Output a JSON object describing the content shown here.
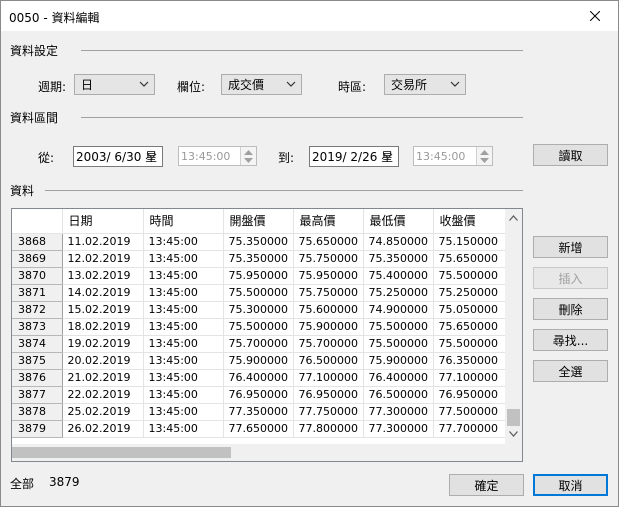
{
  "window": {
    "title": "0050 - 資料編輯"
  },
  "settings": {
    "group_label": "資料設定",
    "period_label": "週期:",
    "period_value": "日",
    "field_label": "欄位:",
    "field_value": "成交價",
    "timezone_label": "時區:",
    "timezone_value": "交易所"
  },
  "range": {
    "group_label": "資料區間",
    "from_label": "從:",
    "from_date": "2003/ 6/30 星",
    "from_time": "13:45:00",
    "to_label": "到:",
    "to_date": "2019/ 2/26 星",
    "to_time": "13:45:00",
    "read_button": "讀取"
  },
  "data_section": {
    "group_label": "資料",
    "columns": [
      "日期",
      "時間",
      "開盤價",
      "最高價",
      "最低價",
      "收盤價"
    ],
    "rows": [
      {
        "id": "3868",
        "cells": [
          "11.02.2019",
          "13:45:00",
          "75.350000",
          "75.650000",
          "74.850000",
          "75.150000"
        ]
      },
      {
        "id": "3869",
        "cells": [
          "12.02.2019",
          "13:45:00",
          "75.350000",
          "75.750000",
          "75.350000",
          "75.650000"
        ]
      },
      {
        "id": "3870",
        "cells": [
          "13.02.2019",
          "13:45:00",
          "75.950000",
          "75.950000",
          "75.400000",
          "75.500000"
        ]
      },
      {
        "id": "3871",
        "cells": [
          "14.02.2019",
          "13:45:00",
          "75.500000",
          "75.750000",
          "75.250000",
          "75.250000"
        ]
      },
      {
        "id": "3872",
        "cells": [
          "15.02.2019",
          "13:45:00",
          "75.300000",
          "75.600000",
          "74.900000",
          "75.050000"
        ]
      },
      {
        "id": "3873",
        "cells": [
          "18.02.2019",
          "13:45:00",
          "75.500000",
          "75.900000",
          "75.500000",
          "75.650000"
        ]
      },
      {
        "id": "3874",
        "cells": [
          "19.02.2019",
          "13:45:00",
          "75.700000",
          "75.700000",
          "75.500000",
          "75.500000"
        ]
      },
      {
        "id": "3875",
        "cells": [
          "20.02.2019",
          "13:45:00",
          "75.900000",
          "76.500000",
          "75.900000",
          "76.350000"
        ]
      },
      {
        "id": "3876",
        "cells": [
          "21.02.2019",
          "13:45:00",
          "76.400000",
          "77.100000",
          "76.400000",
          "77.100000"
        ]
      },
      {
        "id": "3877",
        "cells": [
          "22.02.2019",
          "13:45:00",
          "76.950000",
          "76.950000",
          "76.500000",
          "76.950000"
        ]
      },
      {
        "id": "3878",
        "cells": [
          "25.02.2019",
          "13:45:00",
          "77.350000",
          "77.750000",
          "77.300000",
          "77.500000"
        ]
      },
      {
        "id": "3879",
        "cells": [
          "26.02.2019",
          "13:45:00",
          "77.650000",
          "77.800000",
          "77.300000",
          "77.700000"
        ]
      }
    ]
  },
  "side_buttons": {
    "add": "新增",
    "insert": "插入",
    "delete": "刪除",
    "find": "尋找...",
    "select_all": "全選"
  },
  "footer": {
    "total_label": "全部",
    "total_count": "3879",
    "ok_button": "確定",
    "cancel_button": "取消"
  },
  "colors": {
    "accent": "#0078d7",
    "window_bg": "#f0f0f0"
  }
}
